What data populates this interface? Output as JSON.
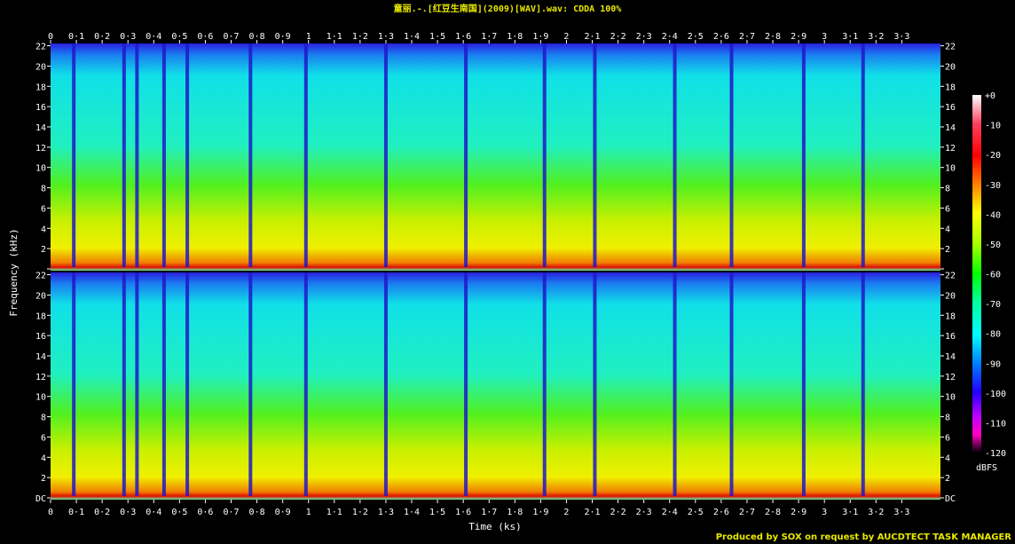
{
  "title": "童丽.-.[红豆生南国](2009)[WAV].wav: CDDA 100%",
  "credit": "Produced by SOX on request by AUCDTECT TASK MANAGER",
  "colors": {
    "background": "#000000",
    "title": "#e8e800",
    "axis": "#ffffff"
  },
  "chart_data": {
    "type": "heatmap",
    "title": "童丽.-.[红豆生南国](2009)[WAV].wav: CDDA 100%",
    "xlabel": "Time (ks)",
    "ylabel": "Frequency (kHz)",
    "xlim": [
      0,
      3.45
    ],
    "ylim": [
      0,
      22.05
    ],
    "channels": 2,
    "x_ticks": [
      "0",
      "0·1",
      "0·2",
      "0·3",
      "0·4",
      "0·5",
      "0·6",
      "0·7",
      "0·8",
      "0·9",
      "1",
      "1·1",
      "1·2",
      "1·3",
      "1·4",
      "1·5",
      "1·6",
      "1·7",
      "1·8",
      "1·9",
      "2",
      "2·1",
      "2·2",
      "2·3",
      "2·4",
      "2·5",
      "2·6",
      "2·7",
      "2·8",
      "2·9",
      "3",
      "3·1",
      "3·2",
      "3·3"
    ],
    "x_tick_values": [
      0,
      0.1,
      0.2,
      0.3,
      0.4,
      0.5,
      0.6,
      0.7,
      0.8,
      0.9,
      1.0,
      1.1,
      1.2,
      1.3,
      1.4,
      1.5,
      1.6,
      1.7,
      1.8,
      1.9,
      2.0,
      2.1,
      2.2,
      2.3,
      2.4,
      2.5,
      2.6,
      2.7,
      2.8,
      2.9,
      3.0,
      3.1,
      3.2,
      3.3
    ],
    "y_ticks": [
      "DC",
      "2",
      "4",
      "6",
      "8",
      "10",
      "12",
      "14",
      "16",
      "18",
      "20",
      "22"
    ],
    "y_tick_values": [
      0,
      2,
      4,
      6,
      8,
      10,
      12,
      14,
      16,
      18,
      20,
      22
    ],
    "colorbar": {
      "label": "dBFS",
      "ticks": [
        "+0",
        "-10",
        "-20",
        "-30",
        "-40",
        "-50",
        "-60",
        "-70",
        "-80",
        "-90",
        "-100",
        "-110",
        "-120"
      ],
      "tick_values": [
        0,
        -10,
        -20,
        -30,
        -40,
        -50,
        -60,
        -70,
        -80,
        -90,
        -100,
        -110,
        -120
      ],
      "range": [
        -120,
        0
      ]
    },
    "track_boundaries_ks": [
      0.09,
      0.285,
      0.335,
      0.44,
      0.53,
      0.775,
      0.99,
      1.3,
      1.61,
      1.915,
      2.11,
      2.42,
      2.64,
      2.92,
      3.15
    ]
  }
}
